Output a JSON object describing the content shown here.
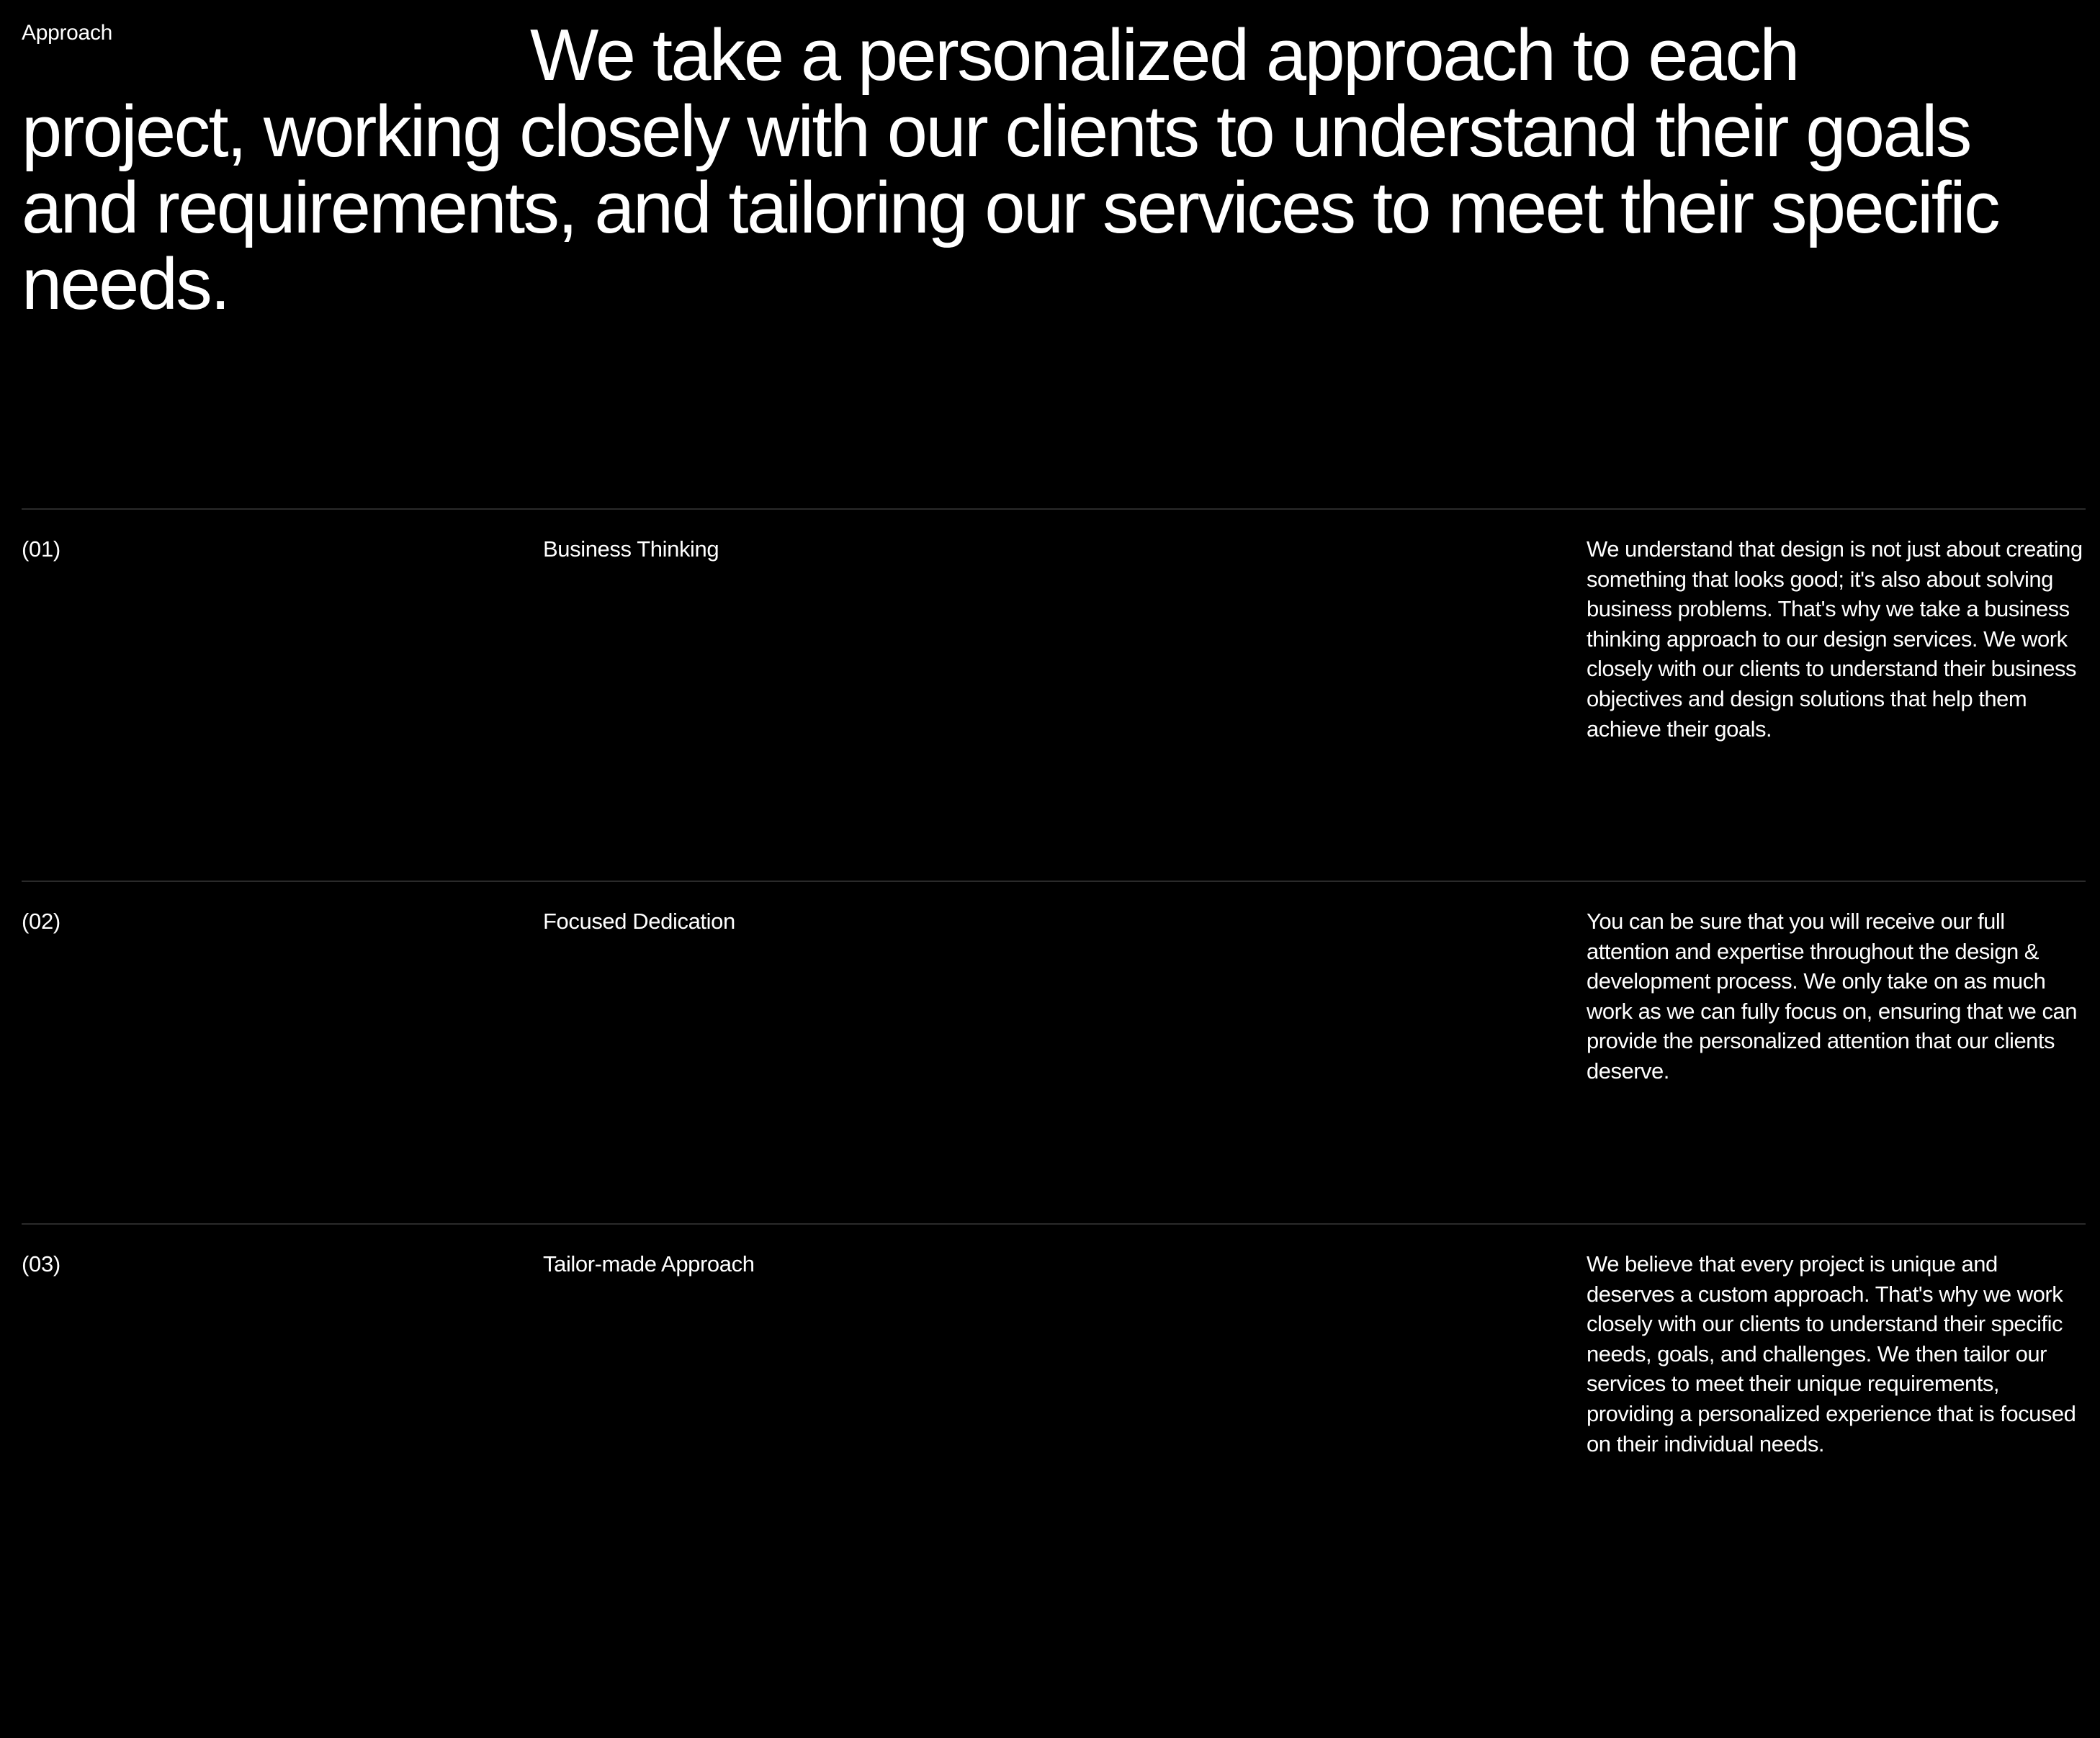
{
  "section": {
    "label": "Approach"
  },
  "headline": "We take a personalized approach to each project, working closely with our clients to understand their goals and requirements, and tailoring our services to meet their specific needs.",
  "items": [
    {
      "number": "(01)",
      "title": "Business Thinking",
      "description": "We understand that design is not just about creating something that looks good; it's also about solving business problems. That's why we take a business thinking approach to our design services. We work closely with our clients to understand their business objectives and design solutions that help them achieve their goals."
    },
    {
      "number": "(02)",
      "title": "Focused Dedication",
      "description": "You can be sure that you will receive our full attention and expertise throughout the design & development process. We only take on as much work as we can fully focus on, ensuring that we can provide the personalized attention that our clients deserve."
    },
    {
      "number": "(03)",
      "title": "Tailor-made Approach",
      "description": "We believe that every project is unique and deserves a custom approach. That's why we work closely with our clients to understand their specific needs, goals, and challenges. We then tailor our services to meet their unique requirements, providing a personalized experience that is focused on their individual needs."
    }
  ],
  "colors": {
    "background": "#000000",
    "text": "#ffffff",
    "divider": "#2a2a2a"
  }
}
